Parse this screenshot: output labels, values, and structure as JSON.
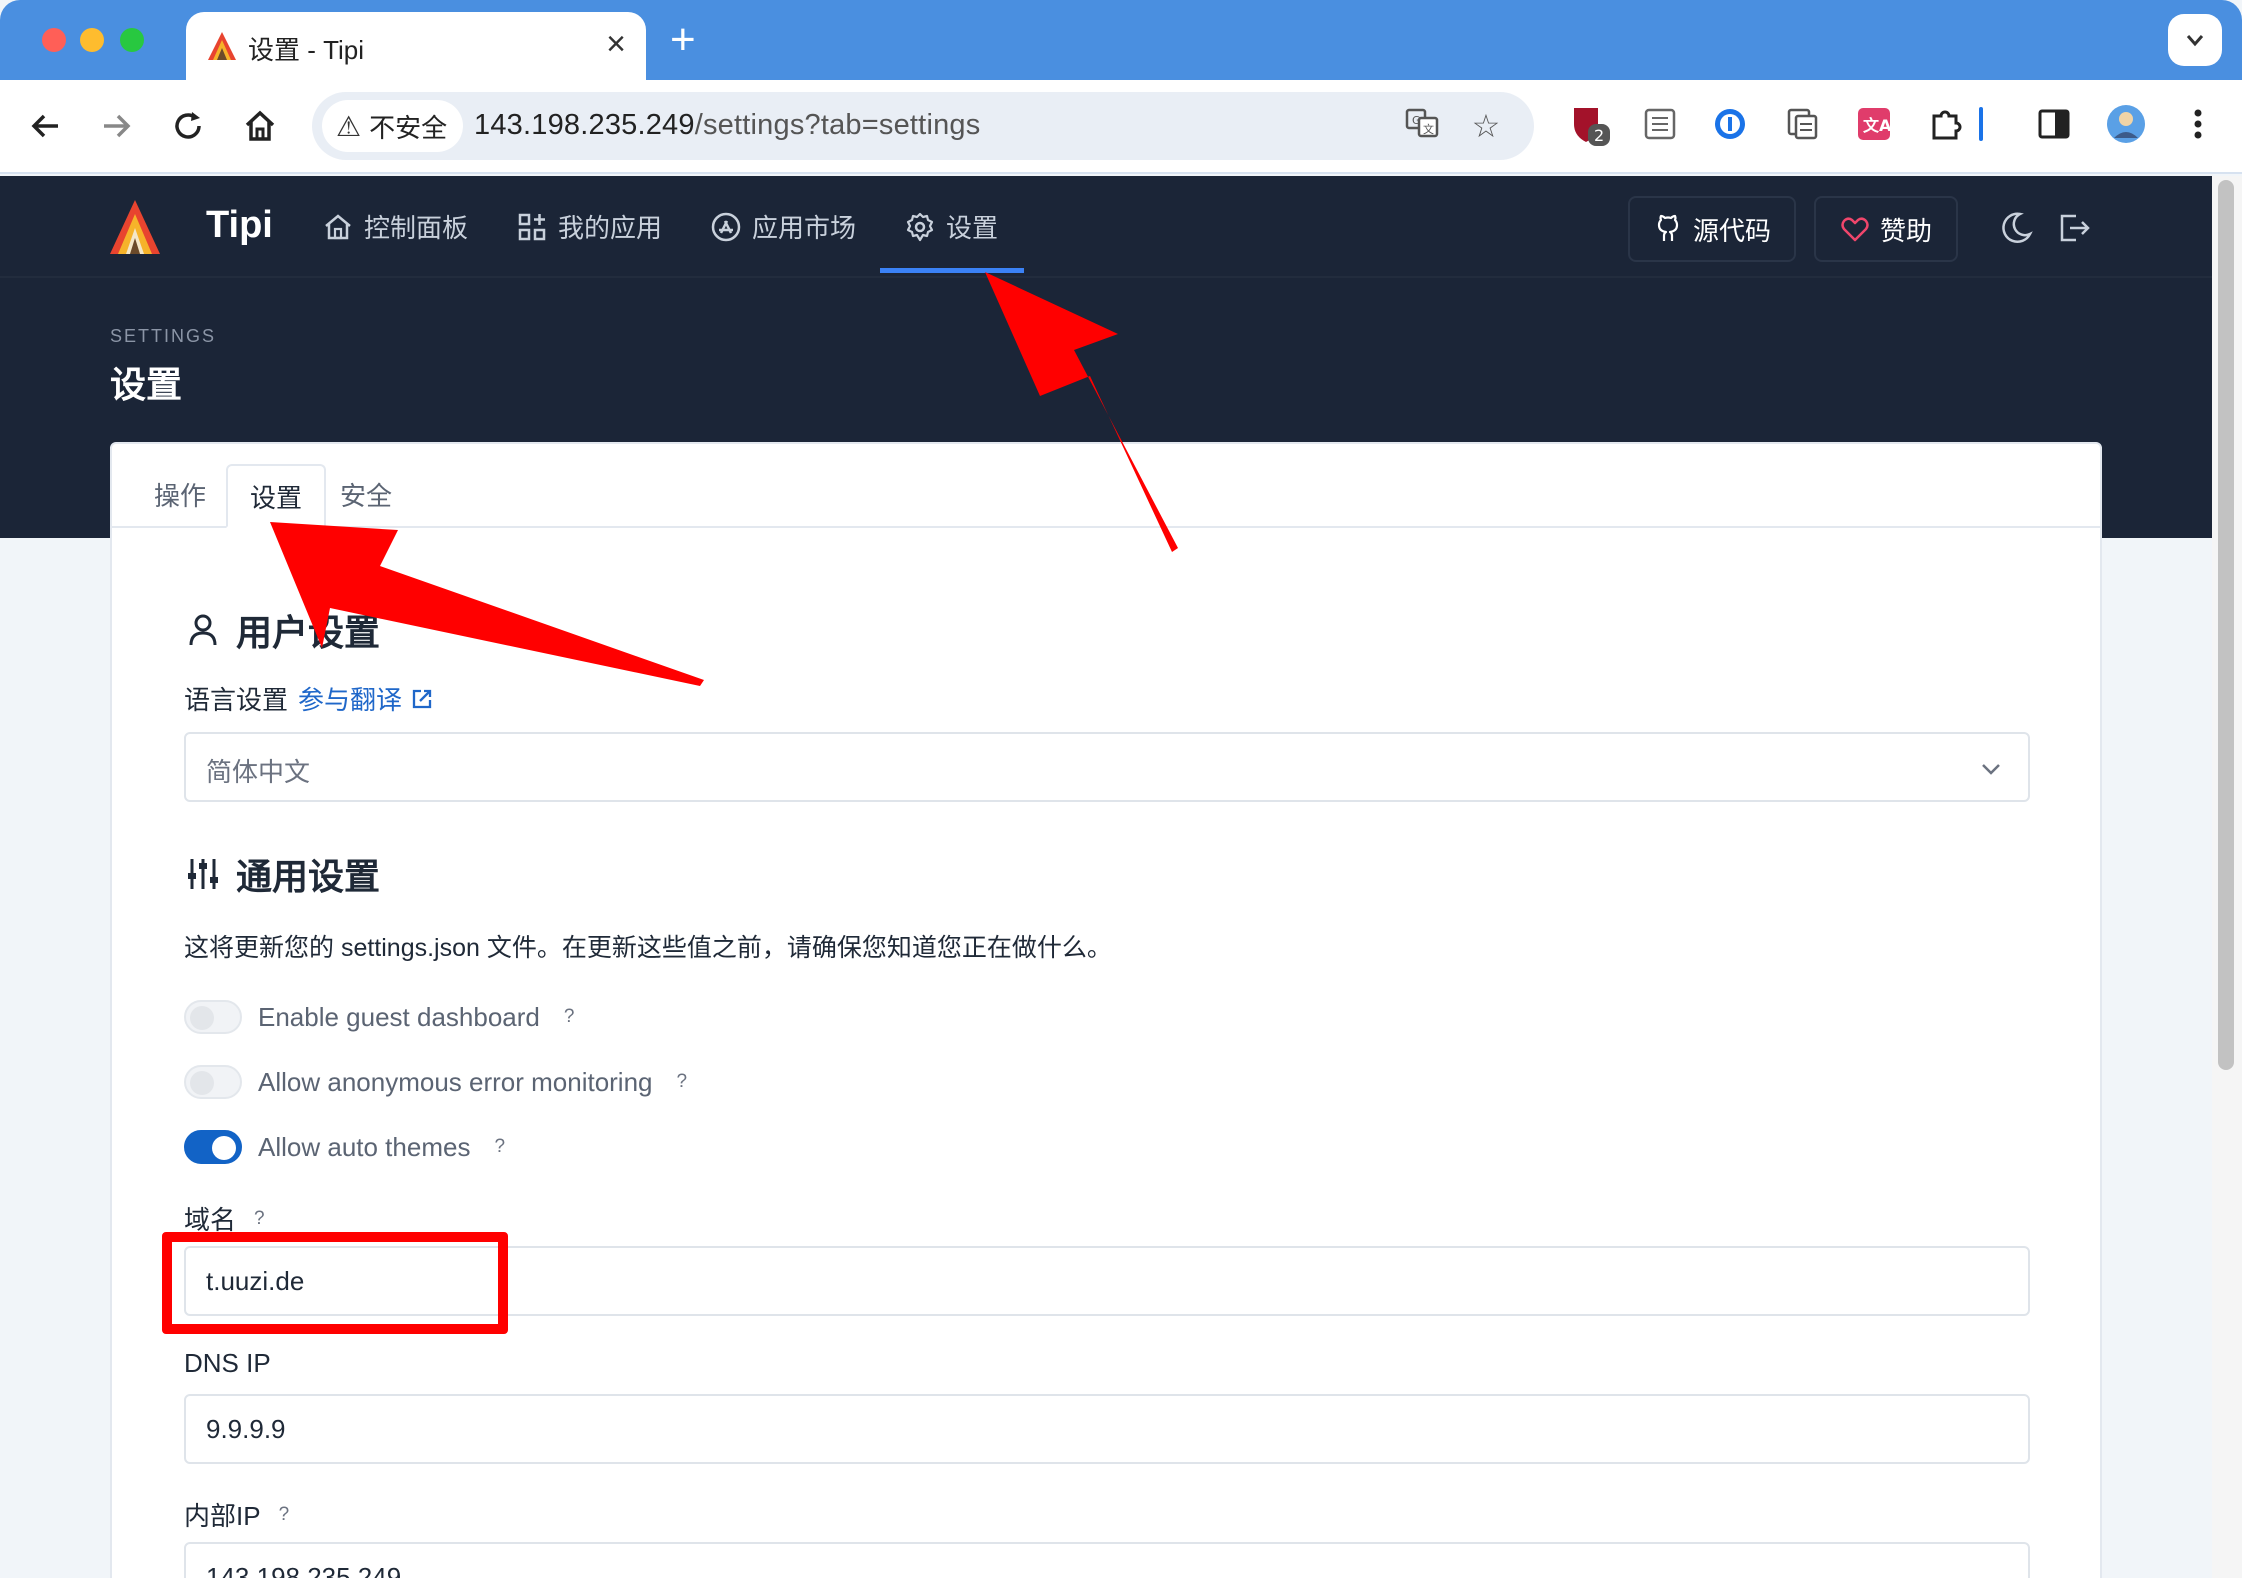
{
  "browser": {
    "tab_title": "设置 - Tipi",
    "security_label": "不安全",
    "url_host": "143.198.235.249",
    "url_path": "/settings?tab=settings",
    "extension_badge": "2"
  },
  "app": {
    "brand": "Tipi",
    "nav": [
      {
        "label": "控制面板",
        "icon": "home-icon"
      },
      {
        "label": "我的应用",
        "icon": "apps-icon"
      },
      {
        "label": "应用市场",
        "icon": "app-store-icon"
      },
      {
        "label": "设置",
        "icon": "gear-icon",
        "active": true
      }
    ],
    "source_code_label": "源代码",
    "sponsor_label": "赞助",
    "page_pretitle": "SETTINGS",
    "page_title": "设置"
  },
  "tabs": [
    "操作",
    "设置",
    "安全"
  ],
  "active_tab": "设置",
  "user_settings": {
    "title": "用户设置",
    "language_label": "语言设置",
    "translate_link": "参与翻译",
    "language_value": "简体中文"
  },
  "general_settings": {
    "title": "通用设置",
    "description": "这将更新您的 settings.json 文件。在更新这些值之前，请确保您知道您正在做什么。",
    "toggles": [
      {
        "label": "Enable guest dashboard",
        "on": false
      },
      {
        "label": "Allow anonymous error monitoring",
        "on": false
      },
      {
        "label": "Allow auto themes",
        "on": true
      }
    ],
    "help_mark": "?",
    "domain_label": "域名",
    "domain_value": "t.uuzi.de",
    "dns_label": "DNS IP",
    "dns_value": "9.9.9.9",
    "internal_ip_label": "内部IP",
    "internal_ip_value": "143.198.235.249"
  },
  "colors": {
    "header_bg": "#1b2537",
    "accent": "#1263c6",
    "annotation": "#ff0000"
  }
}
